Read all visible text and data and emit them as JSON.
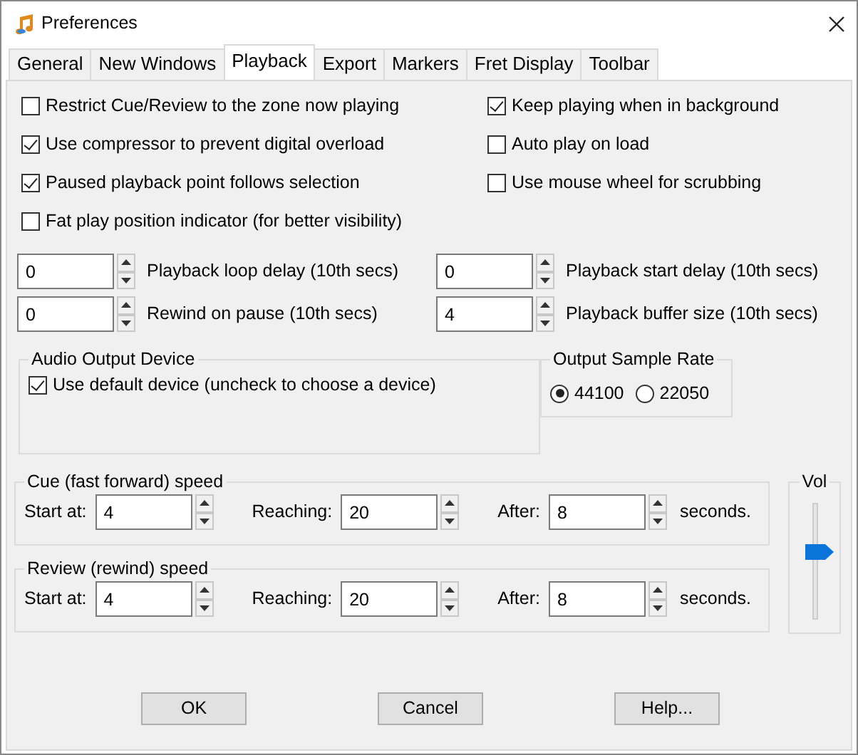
{
  "window": {
    "title": "Preferences"
  },
  "tabs": [
    {
      "label": "General",
      "selected": false
    },
    {
      "label": "New Windows",
      "selected": false
    },
    {
      "label": "Playback",
      "selected": true
    },
    {
      "label": "Export",
      "selected": false
    },
    {
      "label": "Markers",
      "selected": false
    },
    {
      "label": "Fret Display",
      "selected": false
    },
    {
      "label": "Toolbar",
      "selected": false
    }
  ],
  "options_left": [
    {
      "label": "Restrict Cue/Review to the zone now playing",
      "checked": false
    },
    {
      "label": "Use compressor to prevent digital overload",
      "checked": true
    },
    {
      "label": "Paused playback point follows selection",
      "checked": true
    },
    {
      "label": "Fat play position indicator (for better visibility)",
      "checked": false
    }
  ],
  "options_right": [
    {
      "label": "Keep playing when in background",
      "checked": true
    },
    {
      "label": "Auto play on load",
      "checked": false
    },
    {
      "label": "Use mouse wheel for scrubbing",
      "checked": false
    }
  ],
  "delays": [
    {
      "spinner": "0",
      "caption": "Playback loop delay (10th secs)"
    },
    {
      "spinner": "0",
      "caption": "Playback start delay (10th secs)"
    },
    {
      "spinner": "0",
      "caption": "Rewind on pause (10th secs)"
    },
    {
      "spinner": "4",
      "caption": "Playback buffer size (10th secs)"
    }
  ],
  "audio_output_device": {
    "title": "Audio Output Device",
    "use_default": {
      "label": "Use default device (uncheck to choose a device)",
      "checked": true
    }
  },
  "output_sample_rate": {
    "title": "Output Sample Rate",
    "options": [
      {
        "label": "44100",
        "selected": true
      },
      {
        "label": "22050",
        "selected": false
      }
    ]
  },
  "speed_groups": [
    {
      "title": "Cue (fast forward) speed",
      "fields": [
        {
          "label": "Start at:",
          "value": "4"
        },
        {
          "label": "Reaching:",
          "value": "20"
        },
        {
          "label": "After:",
          "value": "8"
        }
      ],
      "suffix": "seconds."
    },
    {
      "title": "Review (rewind) speed",
      "fields": [
        {
          "label": "Start at:",
          "value": "4"
        },
        {
          "label": "Reaching:",
          "value": "20"
        },
        {
          "label": "After:",
          "value": "8"
        }
      ],
      "suffix": "seconds."
    }
  ],
  "volume": {
    "title": "Vol",
    "level": 0.6
  },
  "buttons": [
    {
      "label": "OK"
    },
    {
      "label": "Cancel"
    },
    {
      "label": "Help..."
    }
  ]
}
